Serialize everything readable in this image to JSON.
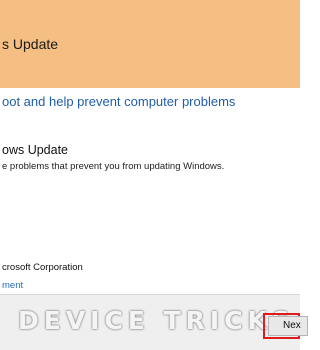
{
  "window": {
    "title": "s Update"
  },
  "main": {
    "heading": "oot and help prevent computer problems",
    "tool_name": "ows Update",
    "tool_description": "e problems that prevent you from updating Windows.",
    "publisher": "crosoft Corporation",
    "link_text": "ment"
  },
  "footer": {
    "watermark": "DEVICE TRICKS",
    "next_label": "Nex",
    "highlight_color": "#e01b1b"
  },
  "colors": {
    "titlebar": "#f5be82",
    "heading": "#1f5fa8",
    "link": "#1f6ec2",
    "footer": "#efefef"
  }
}
